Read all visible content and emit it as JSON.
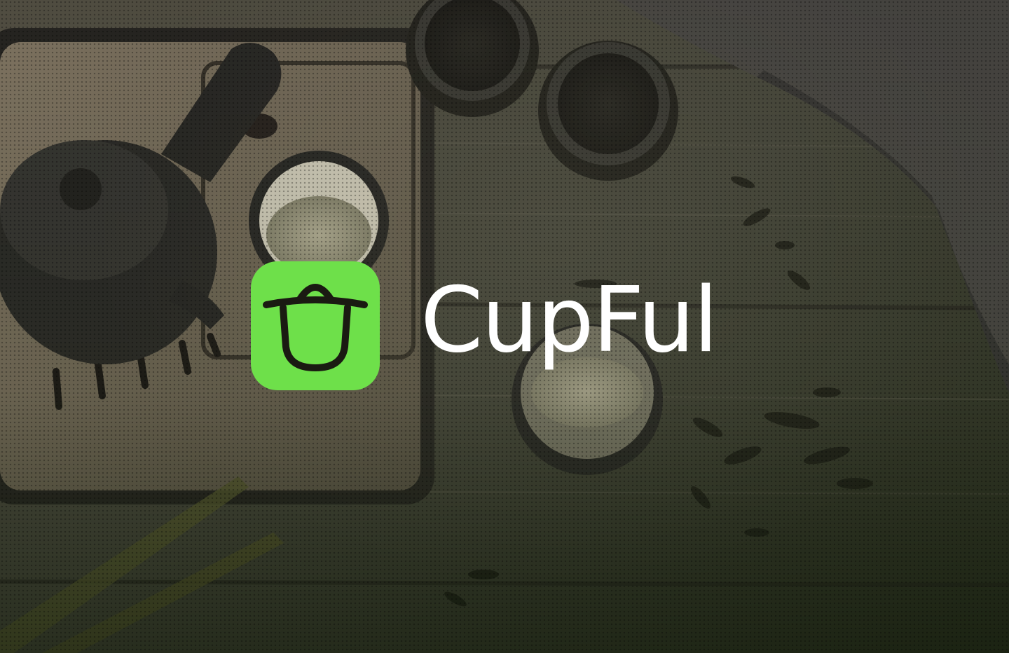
{
  "brand": {
    "name": "CupFul",
    "icon": "cup-with-lid-icon",
    "accent_color": "#6ee04a",
    "icon_stroke_color": "#1a1a12"
  },
  "background": {
    "description_icon": "tea-set-photo",
    "base_color": "#2e2c27"
  }
}
